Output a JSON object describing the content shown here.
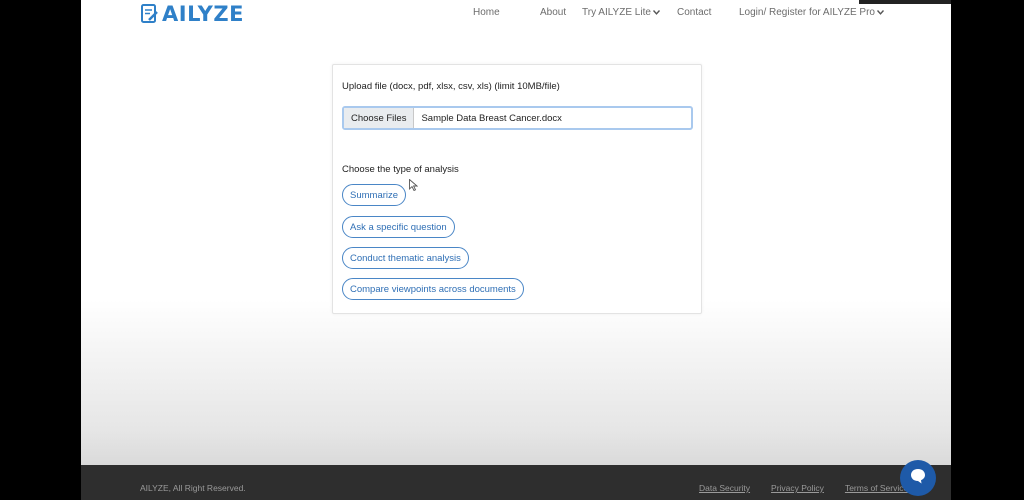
{
  "brand": {
    "name": "AILYZE",
    "color": "#2f80c8",
    "logo_icon": "document-pencil-icon"
  },
  "nav": {
    "items": [
      {
        "label": "Home"
      },
      {
        "label": "About"
      },
      {
        "label": "Try AILYZE Lite",
        "has_dropdown": true
      },
      {
        "label": "Contact"
      },
      {
        "label": "Login/ Register for AILYZE Pro",
        "has_dropdown": true
      }
    ]
  },
  "upload": {
    "label": "Upload file (docx, pdf, xlsx, csv, xls) (limit 10MB/file)",
    "button_label": "Choose Files",
    "file_name": "Sample Data Breast Cancer.docx"
  },
  "analysis": {
    "label": "Choose the type of analysis",
    "options": [
      {
        "label": "Summarize"
      },
      {
        "label": "Ask a specific question"
      },
      {
        "label": "Conduct thematic analysis"
      },
      {
        "label": "Compare viewpoints across documents"
      }
    ]
  },
  "footer": {
    "copyright": "AILYZE, All Right Reserved.",
    "links": [
      {
        "label": "Data Security"
      },
      {
        "label": "Privacy Policy"
      },
      {
        "label": "Terms of Service"
      }
    ]
  },
  "chat": {
    "icon": "chat-bubble-icon",
    "color": "#1e5aa8"
  }
}
